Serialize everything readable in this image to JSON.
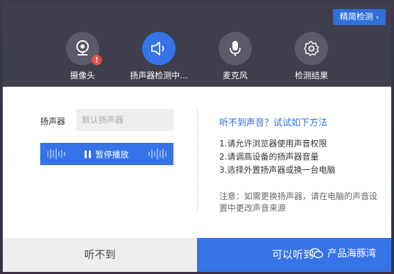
{
  "header": {
    "top_action": "精简检测",
    "steps": [
      {
        "label": "摄像头",
        "icon": "webcam-icon",
        "warning": "!"
      },
      {
        "label": "扬声器检测中...",
        "icon": "speaker-icon",
        "active": true
      },
      {
        "label": "麦克风",
        "icon": "microphone-icon"
      },
      {
        "label": "检测结果",
        "icon": "gear-icon"
      }
    ]
  },
  "speaker": {
    "label": "扬声器",
    "select_value": "默认扬声器",
    "play_button": "暂停播放"
  },
  "tips": {
    "title": "听不到声音？试试如下方法",
    "items": [
      "1.请允许浏览器使用声音权限",
      "2.请调高设备的扬声器音量",
      "3.选择外置扬声器或换一台电脑"
    ],
    "note": "注意：如需更换扬声器，请在电脑的声音设置中更改声音来源"
  },
  "footer": {
    "cant_hear": "听不到",
    "can_hear": "可以听到",
    "watermark": "产品海豚湾"
  },
  "colors": {
    "accent": "#3573e6",
    "header_bg": "#3e3e4d",
    "warning": "#e84a4a"
  }
}
